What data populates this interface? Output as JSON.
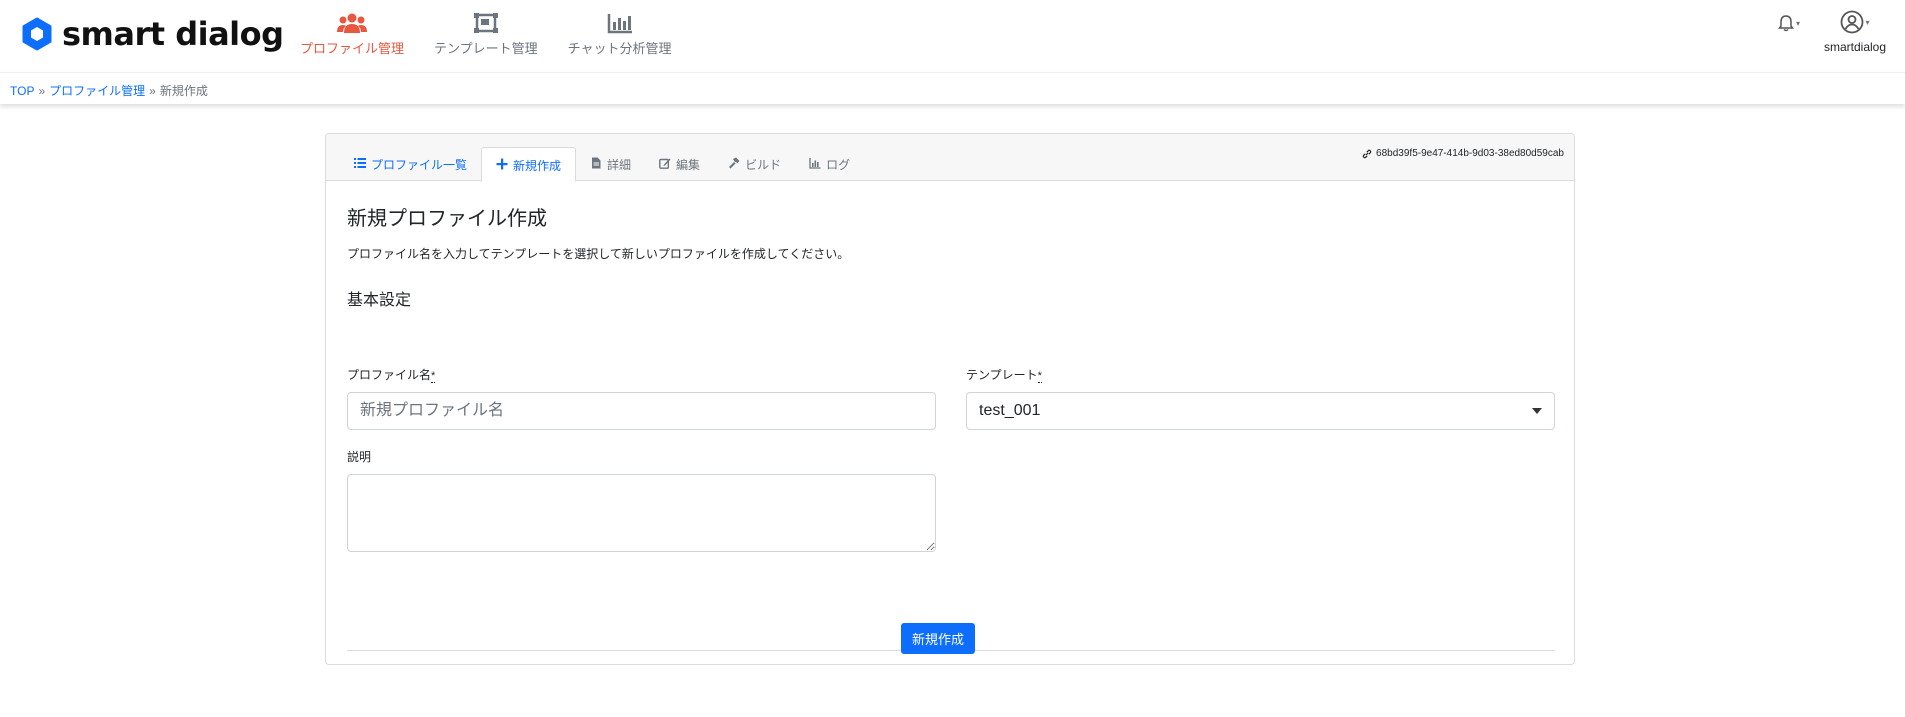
{
  "app": {
    "logo_text": "smart dialog",
    "brand_color": "#0d6efd",
    "active_color": "#e8573f"
  },
  "nav": {
    "items": [
      {
        "label": "プロファイル管理",
        "icon": "users-icon",
        "active": true
      },
      {
        "label": "テンプレート管理",
        "icon": "template-icon",
        "active": false
      },
      {
        "label": "チャット分析管理",
        "icon": "bar-chart-icon",
        "active": false
      }
    ]
  },
  "header": {
    "notifications_icon": "bell-icon",
    "user_icon": "user-circle-icon",
    "user_name": "smartdialog"
  },
  "breadcrumb": {
    "items": [
      "TOP",
      "プロファイル管理",
      "新規作成"
    ],
    "separator": "»"
  },
  "tabs": [
    {
      "label": "プロファイル一覧",
      "icon": "list-icon"
    },
    {
      "label": "新規作成",
      "icon": "plus-icon"
    },
    {
      "label": "詳細",
      "icon": "file-icon"
    },
    {
      "label": "編集",
      "icon": "edit-icon"
    },
    {
      "label": "ビルド",
      "icon": "hammer-icon"
    },
    {
      "label": "ログ",
      "icon": "chart-icon"
    }
  ],
  "uuid": "68bd39f5-9e47-414b-9d03-38ed80d59cab",
  "form": {
    "title": "新規プロファイル作成",
    "description": "プロファイル名を入力してテンプレートを選択して新しいプロファイルを作成してください。",
    "section": "基本設定",
    "name_label": "プロファイル名",
    "required_mark": "*",
    "name_placeholder": "新規プロファイル名",
    "name_value": "",
    "template_label": "テンプレート",
    "template_value": "test_001",
    "description_label": "説明",
    "description_value": "",
    "submit_label": "新規作成"
  }
}
